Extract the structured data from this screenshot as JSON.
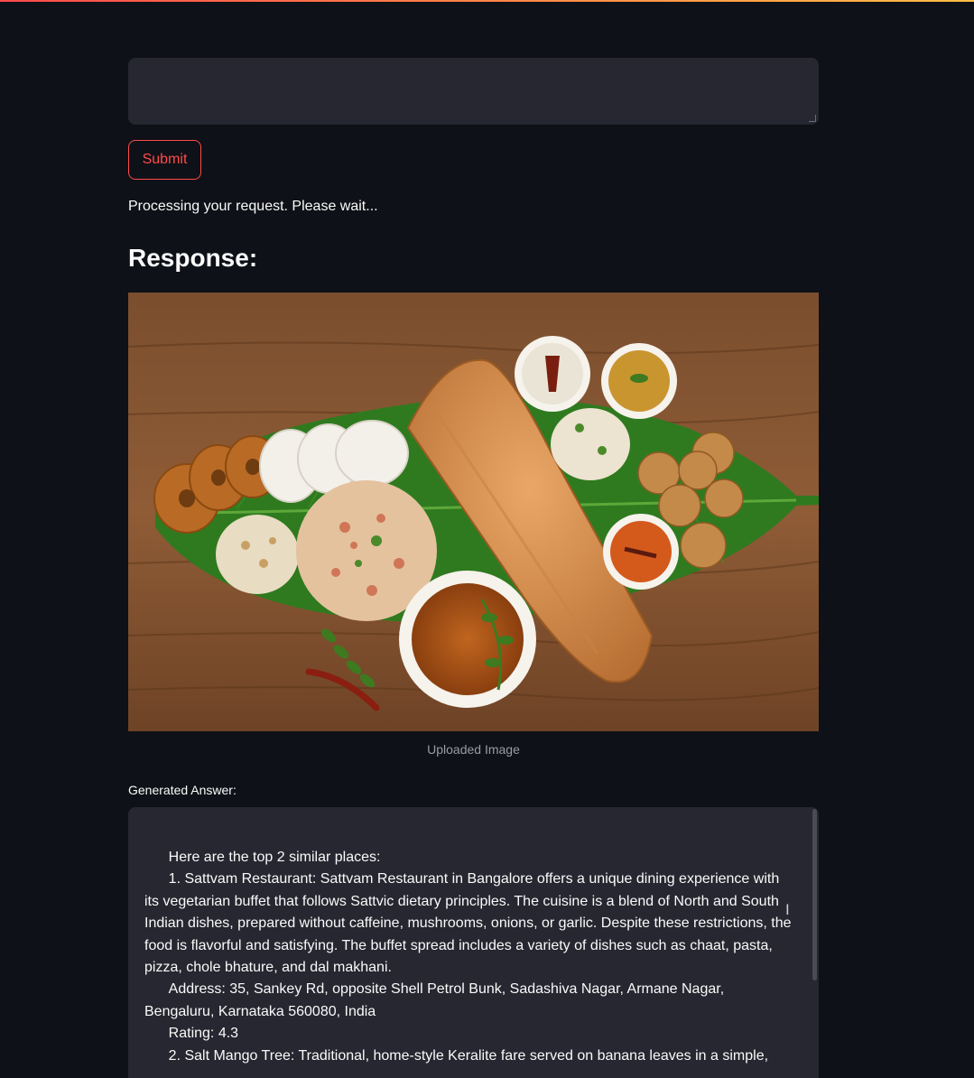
{
  "form": {
    "submit_label": "Submit"
  },
  "status": {
    "message": "Processing your request. Please wait..."
  },
  "response": {
    "heading": "Response:",
    "image_caption": "Uploaded Image",
    "answer_label": "Generated Answer:",
    "answer_text": "      Here are the top 2 similar places:\n      1. Sattvam Restaurant: Sattvam Restaurant in Bangalore offers a unique dining experience with its vegetarian buffet that follows Sattvic dietary principles. The cuisine is a blend of North and South Indian dishes, prepared without caffeine, mushrooms, onions, or garlic. Despite these restrictions, the food is flavorful and satisfying. The buffet spread includes a variety of dishes such as chaat, pasta, pizza, chole bhature, and dal makhani.\n      Address: 35, Sankey Rd, opposite Shell Petrol Bunk, Sadashiva Nagar, Armane Nagar, Bengaluru, Karnataka 560080, India\n      Rating: 4.3\n      2. Salt Mango Tree: Traditional, home-style Keralite fare served on banana leaves in a simple,"
  },
  "colors": {
    "background": "#0e1117",
    "surface": "#262730",
    "accent": "#ff4b4b",
    "text": "#fafafa"
  },
  "icons": {
    "text_cursor": "i-beam-cursor-icon",
    "resize": "resize-grip-icon"
  }
}
